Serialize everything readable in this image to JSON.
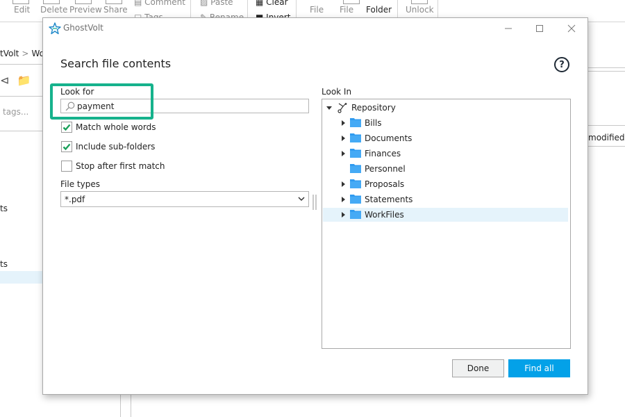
{
  "background_app": {
    "ribbon": {
      "items": [
        {
          "label": "Edit",
          "enabled": false
        },
        {
          "label": "Delete",
          "enabled": false
        },
        {
          "label": "Preview",
          "enabled": false
        },
        {
          "label": "Share",
          "enabled": false
        },
        {
          "label": "Comment",
          "enabled": false
        },
        {
          "label": "Tags",
          "enabled": false
        },
        {
          "label": "Paste",
          "enabled": false
        },
        {
          "label": "Rename",
          "enabled": false
        },
        {
          "label": "Clear",
          "enabled": true
        },
        {
          "label": "Invert",
          "enabled": true
        },
        {
          "label": "File",
          "enabled": false
        },
        {
          "label": "File",
          "enabled": false
        },
        {
          "label": "Folder",
          "enabled": true
        },
        {
          "label": "Unlock",
          "enabled": false
        }
      ]
    },
    "breadcrumb": {
      "items": [
        "tVolt",
        "Wo"
      ],
      "separator": ">"
    },
    "tags_placeholder": "tags...",
    "sidebar_fragments": [
      "ts",
      "ts"
    ],
    "column_header": "modified"
  },
  "dialog": {
    "app_title": "GhostVolt",
    "window_controls": {
      "minimize": "minimize-icon",
      "maximize": "maximize-icon",
      "close": "close-icon"
    },
    "heading": "Search file contents",
    "help_label": "?",
    "look_for": {
      "label": "Look for",
      "value": "payment",
      "icon": "search-icon"
    },
    "options": [
      {
        "label": "Match whole words",
        "checked": true
      },
      {
        "label": "Include sub-folders",
        "checked": true
      },
      {
        "label": "Stop after first match",
        "checked": false
      }
    ],
    "file_types": {
      "label": "File types",
      "selected": "*.pdf"
    },
    "look_in": {
      "label": "Look In",
      "root": {
        "label": "Repository",
        "expanded": true,
        "icon": "repository-branch-icon"
      },
      "folders": [
        {
          "label": "Bills",
          "has_children": true,
          "selected": false
        },
        {
          "label": "Documents",
          "has_children": true,
          "selected": false
        },
        {
          "label": "Finances",
          "has_children": true,
          "selected": false
        },
        {
          "label": "Personnel",
          "has_children": false,
          "selected": false
        },
        {
          "label": "Proposals",
          "has_children": true,
          "selected": false
        },
        {
          "label": "Statements",
          "has_children": true,
          "selected": false
        },
        {
          "label": "WorkFiles",
          "has_children": true,
          "selected": true
        }
      ]
    },
    "buttons": {
      "done": "Done",
      "find_all": "Find all"
    },
    "colors": {
      "accent": "#03a1e8",
      "highlight": "#16b28c",
      "check": "#1aa05a",
      "folder": "#2f9bf0",
      "selection": "#e5f3fb"
    }
  }
}
